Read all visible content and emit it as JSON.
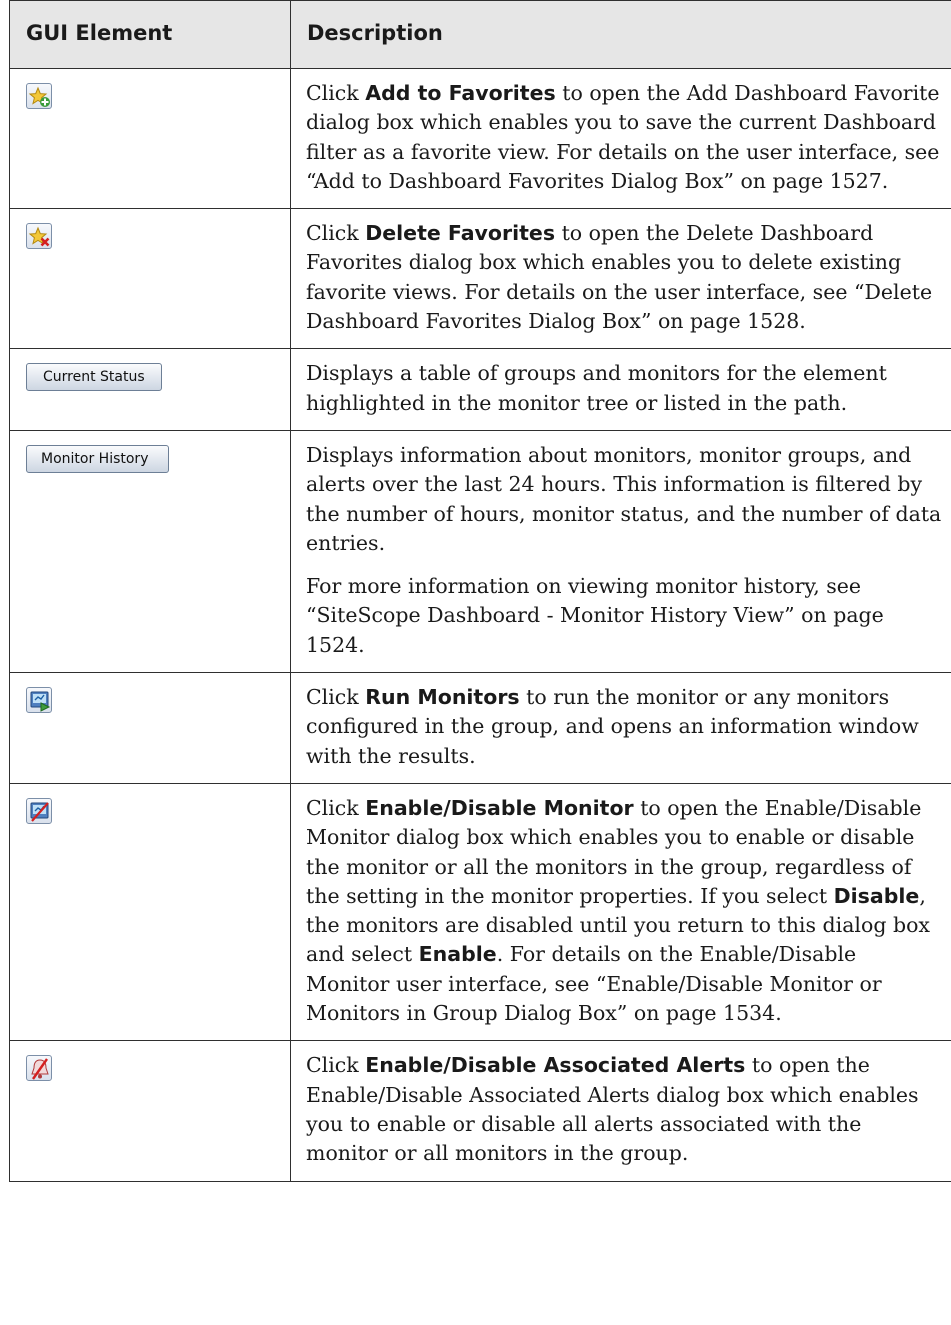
{
  "table": {
    "headers": [
      "GUI Element",
      "Description"
    ],
    "rows": [
      {
        "element": {
          "type": "icon",
          "icon": "add-to-favorites-icon"
        },
        "paragraphs": [
          [
            {
              "t": "Click "
            },
            {
              "t": "Add to Favorites",
              "b": true
            },
            {
              "t": " to open the Add Dashboard Favorite dialog box which enables you to save the current Dashboard filter as a favorite view. For details on the user interface, see “Add to Dashboard Favorites Dialog Box” on page 1527."
            }
          ]
        ]
      },
      {
        "element": {
          "type": "icon",
          "icon": "delete-favorites-icon"
        },
        "paragraphs": [
          [
            {
              "t": "Click "
            },
            {
              "t": "Delete Favorites",
              "b": true
            },
            {
              "t": " to open the Delete Dashboard Favorites dialog box which enables you to delete existing favorite views. For details on the user interface, see “Delete Dashboard Favorites Dialog Box” on page 1528."
            }
          ]
        ]
      },
      {
        "element": {
          "type": "button",
          "label": "Current Status"
        },
        "paragraphs": [
          [
            {
              "t": "Displays a table of groups and monitors for the element highlighted in the monitor tree or listed in the path."
            }
          ]
        ]
      },
      {
        "element": {
          "type": "button",
          "label": "Monitor History"
        },
        "paragraphs": [
          [
            {
              "t": "Displays information about monitors, monitor groups, and alerts over the last 24 hours. This information is filtered by the number of hours, monitor status, and the number of data entries."
            }
          ],
          [
            {
              "t": "For more information on viewing monitor history, see “SiteScope Dashboard - Monitor History View” on page 1524."
            }
          ]
        ]
      },
      {
        "element": {
          "type": "icon",
          "icon": "run-monitors-icon"
        },
        "paragraphs": [
          [
            {
              "t": "Click "
            },
            {
              "t": "Run Monitors",
              "b": true
            },
            {
              "t": " to run the monitor or any monitors configured in the group, and opens an information window with the results."
            }
          ]
        ]
      },
      {
        "element": {
          "type": "icon",
          "icon": "enable-disable-monitor-icon"
        },
        "paragraphs": [
          [
            {
              "t": "Click "
            },
            {
              "t": "Enable/Disable Monitor",
              "b": true
            },
            {
              "t": " to open the Enable/Disable Monitor dialog box which enables you to enable or disable the monitor or all the monitors in the group, regardless of the setting in the monitor properties. If you select "
            },
            {
              "t": "Disable",
              "b": true
            },
            {
              "t": ", the monitors are disabled until you return to this dialog box and select "
            },
            {
              "t": "Enable",
              "b": true
            },
            {
              "t": ". For details on the Enable/Disable Monitor user interface, see “Enable/Disable Monitor or Monitors in Group Dialog Box” on page 1534."
            }
          ]
        ]
      },
      {
        "element": {
          "type": "icon",
          "icon": "enable-disable-alerts-icon"
        },
        "paragraphs": [
          [
            {
              "t": "Click "
            },
            {
              "t": "Enable/Disable Associated Alerts",
              "b": true
            },
            {
              "t": " to open the Enable/Disable Associated Alerts dialog box which enables you to enable or disable all alerts associated with the monitor or all monitors in the group."
            }
          ]
        ]
      }
    ]
  }
}
